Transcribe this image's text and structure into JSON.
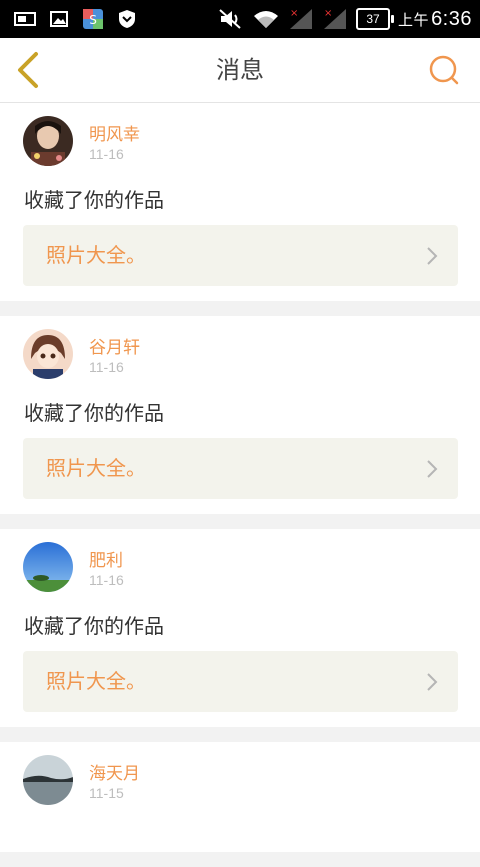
{
  "status_bar": {
    "battery": "37",
    "am_pm": "上午",
    "time": "6:36"
  },
  "header": {
    "title": "消息"
  },
  "messages": [
    {
      "name": "明风幸",
      "date": "11-16",
      "action": "收藏了你的作品",
      "work_title": "照片大全。"
    },
    {
      "name": "谷月轩",
      "date": "11-16",
      "action": "收藏了你的作品",
      "work_title": "照片大全。"
    },
    {
      "name": "肥利",
      "date": "11-16",
      "action": "收藏了你的作品",
      "work_title": "照片大全。"
    },
    {
      "name": "海天月",
      "date": "11-15"
    }
  ],
  "colors": {
    "accent": "#f0964e",
    "back_arrow": "#c9a227"
  }
}
